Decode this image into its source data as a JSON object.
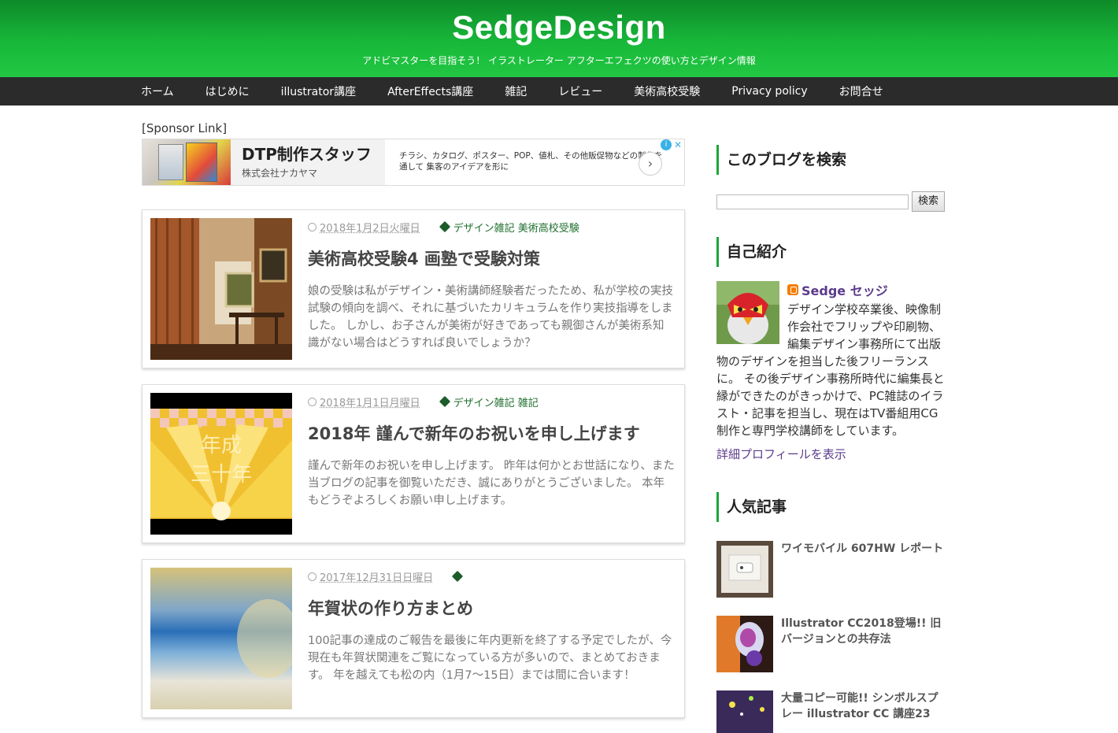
{
  "header": {
    "site_title": "SedgeDesign",
    "site_description": "アドビマスターを目指そう！ イラストレーター アフターエフェクツの使い方とデザイン情報"
  },
  "nav": {
    "items": [
      "ホーム",
      "はじめに",
      "illustrator講座",
      "AfterEffects講座",
      "雑記",
      "レビュー",
      "美術高校受験",
      "Privacy policy",
      "お問合せ"
    ]
  },
  "sponsor": {
    "label": "[Sponsor Link]",
    "ad_title": "DTP制作スタッフ",
    "ad_company": "株式会社ナカヤマ",
    "ad_text": "チラシ、カタログ、ポスター、POP、値札、その他販促物などの製作を通して 集客のアイデアを形に",
    "ad_info": "i",
    "ad_close": "✕",
    "ad_arrow": "›"
  },
  "posts": [
    {
      "date": "2018年1月2日火曜日",
      "tags": "デザイン雑記  美術高校受験",
      "title": "美術高校受験4 画塾で受験対策",
      "excerpt": "娘の受験は私がデザイン・美術講師経験者だったため、私が学校の実技試験の傾向を調べ、それに基づいたカリキュラムを作り実技指導をしました。 しかし、お子さんが美術が好きであっても親御さんが美術系知識がない場合はどうすれば良いでしょうか？"
    },
    {
      "date": "2018年1月1日月曜日",
      "tags": "デザイン雑記  雑記",
      "title": "2018年 謹んで新年のお祝いを申し上げます",
      "excerpt": "謹んで新年のお祝いを申し上げます。 昨年は何かとお世話になり、また当ブログの記事を御覧いただき、誠にありがとうございました。 本年もどうぞよろしくお願い申し上げます。"
    },
    {
      "date": "2017年12月31日日曜日",
      "tags": "",
      "title": "年賀状の作り方まとめ",
      "excerpt": "100記事の達成のご報告を最後に年内更新を終了する予定でしたが、今現在も年賀状関連をご覧になっている方が多いので、まとめておきます。 年を越えても松の内（1月7〜15日）までは間に合います！"
    }
  ],
  "sidebar": {
    "search_title": "このブログを検索",
    "search_button": "検索",
    "search_value": "",
    "profile_title": "自己紹介",
    "profile_name": "Sedge セッジ",
    "profile_text": "デザイン学校卒業後、映像制作会社でフリップや印刷物、編集デザイン事務所にて出版物のデザインを担当した後フリーランスに。 その後デザイン事務所時代に編集長と縁ができたのがきっかけで、PC雑誌のイラスト・記事を担当し、現在はTV番組用CG制作と専門学校講師をしています。",
    "profile_link": "詳細プロフィールを表示",
    "popular_title": "人気記事",
    "popular": [
      "ワイモバイル 607HW レポート",
      "Illustrator CC2018登場!! 旧バージョンとの共存法",
      "大量コピー可能!! シンボルスプレー illustrator CC 講座23"
    ]
  },
  "colors": {
    "header_green": "#18b83a",
    "nav_bg": "#2b2b2b",
    "accent_green": "#1ca63a",
    "profile_purple": "#5b3b8b"
  }
}
